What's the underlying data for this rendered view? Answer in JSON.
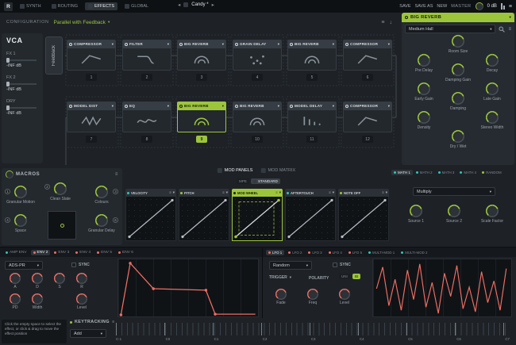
{
  "colors": {
    "accent_green": "#9dc53c",
    "accent_red": "#ee6e63",
    "accent_teal": "#2fc6b7"
  },
  "topbar": {
    "logo": "R",
    "tabs": [
      {
        "label": "SYNTH"
      },
      {
        "label": "ROUTING"
      },
      {
        "label": "EFFECTS"
      },
      {
        "label": "GLOBAL"
      }
    ],
    "preset": {
      "name": "Candy *"
    },
    "save": "SAVE",
    "save_as": "SAVE AS",
    "new": "NEW",
    "master_label": "MASTER",
    "master_value": "0 dB"
  },
  "config": {
    "label": "CONFIGURATION",
    "value": "Parallel with Feedback"
  },
  "vca": {
    "title": "VCA",
    "feedback": "Feedback",
    "channels": [
      {
        "label": "FX 1",
        "value": "-INF dB"
      },
      {
        "label": "FX 2",
        "value": "-INF dB"
      },
      {
        "label": "DRY",
        "value": "-INF dB"
      }
    ]
  },
  "rack": {
    "row1": [
      {
        "name": "COMPRESSOR",
        "num": "1"
      },
      {
        "name": "FILTER",
        "num": "2"
      },
      {
        "name": "BIG REVERB",
        "num": "3"
      },
      {
        "name": "GRAIN DELAY",
        "num": "4"
      },
      {
        "name": "BIG REVERB",
        "num": "5"
      },
      {
        "name": "COMPRESSOR",
        "num": "6"
      }
    ],
    "row2": [
      {
        "name": "MODEL DIST",
        "num": "7"
      },
      {
        "name": "EQ",
        "num": "8"
      },
      {
        "name": "BIG REVERB",
        "num": "9"
      },
      {
        "name": "BIG REVERB",
        "num": "10"
      },
      {
        "name": "MODEL DELAY",
        "num": "11"
      },
      {
        "name": "COMPRESSOR",
        "num": "12"
      }
    ]
  },
  "detail": {
    "title": "BIG REVERB",
    "preset": "Medium Hall",
    "knobs": [
      "Room Size",
      "Pre Delay",
      "Decay",
      "Damping Gain",
      "Early Gain",
      "Late Gain",
      "Damping",
      "Density",
      "Stereo Width",
      "Dry / Wet"
    ]
  },
  "macros": {
    "title": "MACROS",
    "knobs": [
      {
        "num": "1",
        "label": "Granular Motion"
      },
      {
        "num": "2",
        "label": "Clean Slate"
      },
      {
        "num": "3",
        "label": "Colours"
      },
      {
        "num": "4",
        "label": "Space"
      },
      {
        "num": "6",
        "label": "Granular Delay"
      }
    ]
  },
  "modpanels": {
    "tab_panels": "MOD PANELS",
    "tab_matrix": "MOD MATRIX",
    "mpe": "MPE",
    "standard": "STANDARD",
    "sources": [
      {
        "name": "VELOCITY"
      },
      {
        "name": "PITCH"
      },
      {
        "name": "MOD WHEEL"
      },
      {
        "name": "AFTERTOUCH"
      },
      {
        "name": "NOTE OFF"
      }
    ]
  },
  "math": {
    "tabs": [
      "MATH 1",
      "MATH 2",
      "MATH 3",
      "MATH 4",
      "RANDOM"
    ],
    "operation": "Multiply",
    "knobs": [
      "Source 1",
      "Source 2",
      "Scale Factor"
    ]
  },
  "env": {
    "tabs": [
      "AMP ENV",
      "ENV 2",
      "ENV 3",
      "ENV 4",
      "ENV 5",
      "ENV 6"
    ],
    "mode": "ADS-PR",
    "sync": "SYNC",
    "knobs": [
      "A",
      "D",
      "S",
      "R",
      "PD",
      "Width",
      "Level"
    ]
  },
  "lfo": {
    "tabs": [
      "LFO 1",
      "LFO 2",
      "LFO 3",
      "LFO 4",
      "LFO 5",
      "MULTI-MOD 1",
      "MULTI-MOD 2"
    ],
    "shape": "Random",
    "sync": "SYNC",
    "trigger": "TRIGGER",
    "polarity": "POLARITY",
    "uni": "UNI",
    "bi": "BI",
    "knobs": [
      "Fade",
      "Freq",
      "Level"
    ]
  },
  "footer": {
    "hint": "Click the empty space to select the effect, or click & drag to move the effect position",
    "keytracking": {
      "title": "KEYTRACKING",
      "add": "Add",
      "octaves": [
        "C-1",
        "C0",
        "C1",
        "C2",
        "C3",
        "C4",
        "C5",
        "C6",
        "C7"
      ]
    }
  }
}
